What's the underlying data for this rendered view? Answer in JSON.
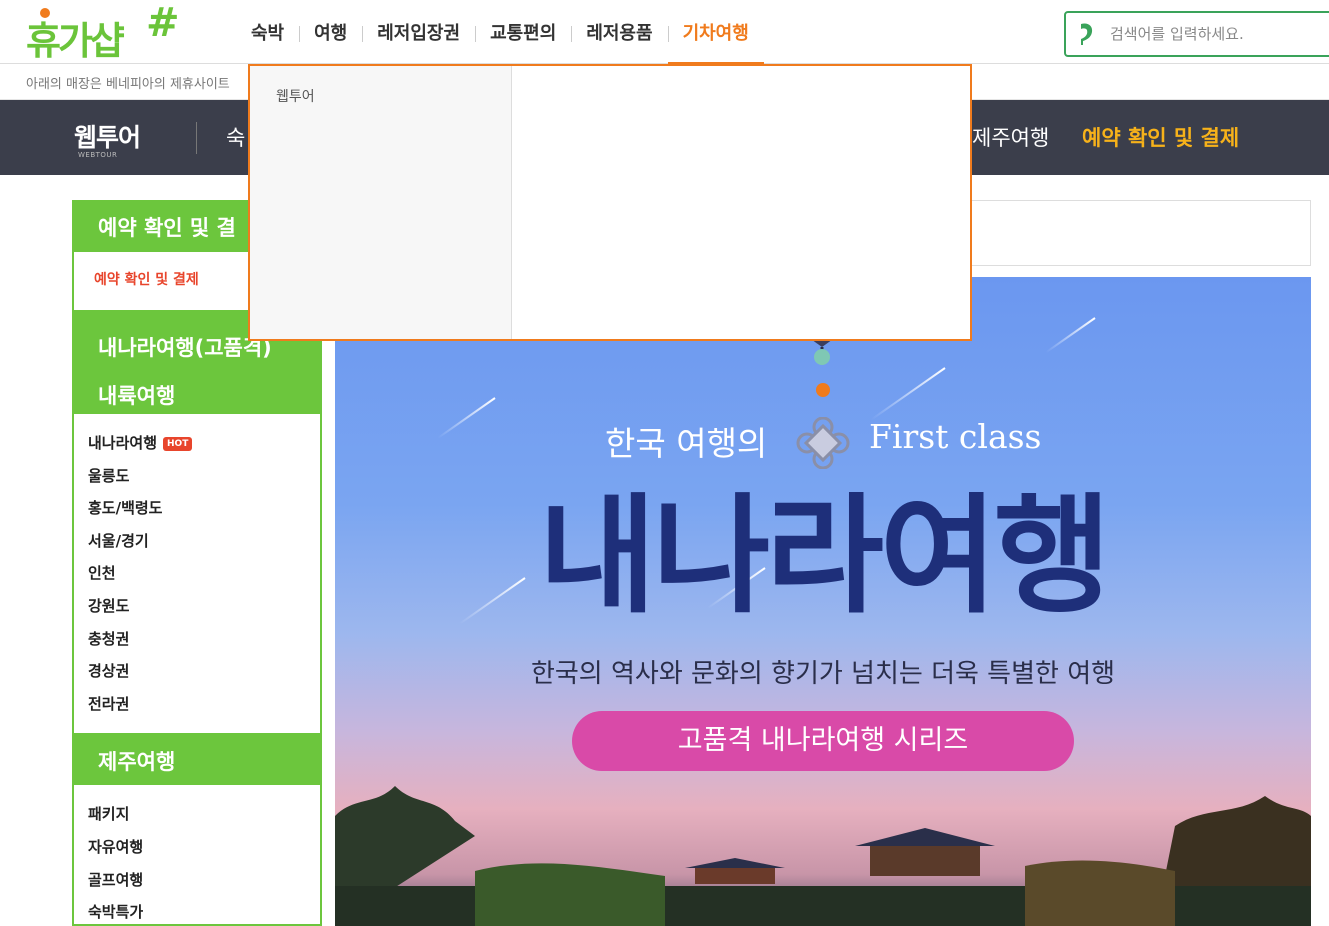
{
  "header": {
    "logo_text": "휴가샵",
    "nav": [
      "숙박",
      "여행",
      "레저입장권",
      "교통편의",
      "레저용품",
      "기차여행"
    ],
    "active_nav_index": 5,
    "search_placeholder": "검색어를 입력하세요.",
    "accent_color": "#f07b1d",
    "brand_color": "#6bc43a"
  },
  "notice": {
    "text": "아래의 매장은 베네피아의 제휴사이트"
  },
  "dropdown": {
    "items": [
      "웹투어"
    ]
  },
  "partner_nav": {
    "logo": "웹투어",
    "logo_sub": "WEBTOUR",
    "items": [
      "숙",
      "제주여행",
      "예약 확인 및 결제"
    ]
  },
  "sidebar": {
    "section1_title": "예약 확인 및 결",
    "section1_sub": "예약 확인 및 결제",
    "section2_title_line1": "내나라여행(고품격)",
    "section2_title_line2": "내륙여행",
    "hot_badge": "HOT",
    "section2_items": [
      "내나라여행",
      "울릉도",
      "홍도/백령도",
      "서울/경기",
      "인천",
      "강원도",
      "충청권",
      "경상권",
      "전라권"
    ],
    "section3_title": "제주여행",
    "section3_items": [
      "패키지",
      "자유여행",
      "골프여행",
      "숙박특가"
    ]
  },
  "banner": {
    "subtitle_left": "한국 여행의",
    "subtitle_right": "First class",
    "title": "내나라여행",
    "description": "한국의 역사와 문화의 향기가 넘치는 더욱 특별한 여행",
    "button": "고품격 내나라여행 시리즈",
    "button_color": "#d94aa8"
  }
}
